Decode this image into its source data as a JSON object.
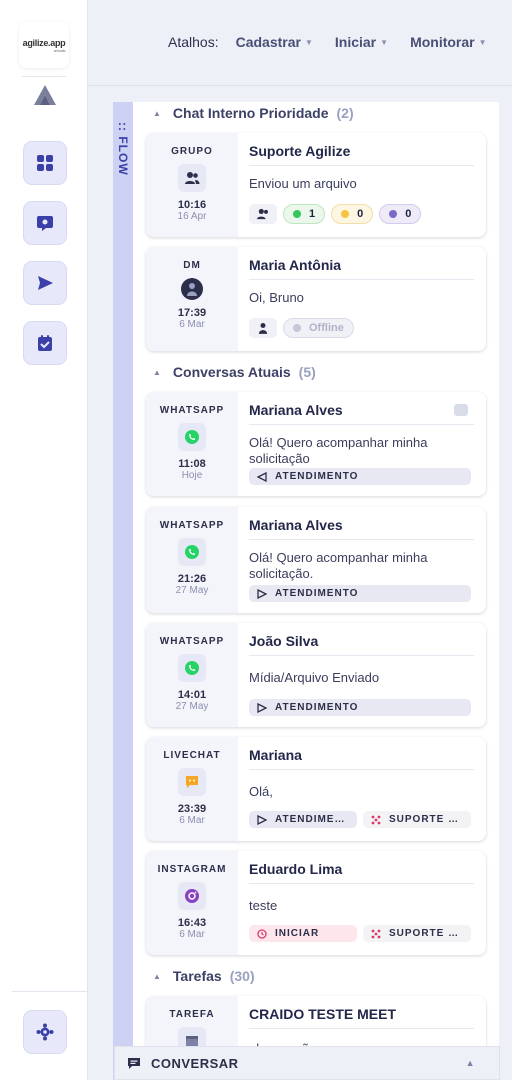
{
  "sidebar": {
    "logo_text": "agilize.app",
    "logo_sub": "ai tools",
    "items": [
      {
        "icon": "grid-icon"
      },
      {
        "icon": "chat-bubble-icon"
      },
      {
        "icon": "send-icon"
      },
      {
        "icon": "calendar-check-icon"
      }
    ],
    "settings_icon": "gear-icon"
  },
  "topbar": {
    "label": "Atalhos:",
    "menus": [
      "Cadastrar",
      "Iniciar",
      "Monitorar"
    ]
  },
  "flow": {
    "rail_label": ":: FLOW",
    "sections": [
      {
        "title": "Chat Interno Prioridade",
        "count": "(2)"
      },
      {
        "title": "Conversas Atuais",
        "count": "(5)"
      },
      {
        "title": "Tarefas",
        "count": "(30)"
      }
    ],
    "cards": [
      {
        "channel": "GRUPO",
        "time": "10:16",
        "date": "16 Apr",
        "name": "Suporte Agilize",
        "message": "Enviou um arquivo",
        "green_count": "1",
        "yellow_count": "0",
        "purple_count": "0"
      },
      {
        "channel": "DM",
        "time": "17:39",
        "date": "6 Mar",
        "name": "Maria Antônia",
        "message": "Oi, Bruno",
        "status": "Offline"
      },
      {
        "channel": "WHATSAPP",
        "time": "11:08",
        "date": "Hoje",
        "name": "Mariana Alves",
        "message": "Olá! Quero acompanhar minha solicitação",
        "pill1": "ATENDIMENTO"
      },
      {
        "channel": "WHATSAPP",
        "time": "21:26",
        "date": "27 May",
        "name": "Mariana Alves",
        "message": "Olá! Quero acompanhar minha solicitação.",
        "pill1": "ATENDIMENTO"
      },
      {
        "channel": "WHATSAPP",
        "time": "14:01",
        "date": "27 May",
        "name": "João Silva",
        "message": "Mídia/Arquivo Enviado",
        "pill1": "ATENDIMENTO"
      },
      {
        "channel": "LIVECHAT",
        "time": "23:39",
        "date": "6 Mar",
        "name": "Mariana",
        "message": "Olá,",
        "pill1": "ATENDIME…",
        "pill2": "SUPORTE …"
      },
      {
        "channel": "INSTAGRAM",
        "time": "16:43",
        "date": "6 Mar",
        "name": "Eduardo Lima",
        "message": "teste",
        "pill1": "INICIAR",
        "pill2": "SUPORTE …"
      },
      {
        "channel": "TAREFA",
        "name": "CRAIDO TESTE MEET",
        "message": "observação"
      }
    ]
  },
  "footer": {
    "label": "CONVERSAR"
  },
  "colors": {
    "accent": "#3a40a8",
    "whatsapp": "#25d366",
    "green": "#34c759",
    "yellow": "#f5c542",
    "purple": "#7d68c8"
  }
}
